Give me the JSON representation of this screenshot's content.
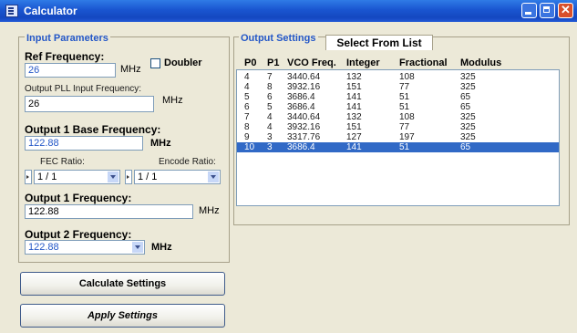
{
  "window": {
    "title": "Calculator"
  },
  "input_params": {
    "section_title": "Input Parameters",
    "ref_freq_label": "Ref Frequency:",
    "ref_freq_value": "26",
    "ref_freq_unit": "MHz",
    "doubler_label": "Doubler",
    "doubler_checked": false,
    "pll_input_label": "Output PLL Input Frequency:",
    "pll_input_value": "26",
    "pll_input_unit": "MHz",
    "out1_base_label": "Output 1 Base Frequency:",
    "out1_base_value": "122.88",
    "out1_base_unit": "MHz",
    "fec_label": "FEC Ratio:",
    "fec_value": "1 / 1",
    "encode_label": "Encode Ratio:",
    "encode_value": "1 / 1",
    "out1_freq_label": "Output 1 Frequency:",
    "out1_freq_value": "122.88",
    "out1_freq_unit": "MHz",
    "out2_freq_label": "Output 2 Frequency:",
    "out2_freq_value": "122.88",
    "out2_freq_unit": "MHz"
  },
  "buttons": {
    "calculate": "Calculate Settings",
    "apply": "Apply Settings"
  },
  "output_settings": {
    "section_title": "Output Settings",
    "tab_label": "Select From List",
    "columns": [
      "P0",
      "P1",
      "VCO Freq.",
      "Integer",
      "Fractional",
      "Modulus"
    ],
    "rows": [
      [
        "4",
        "7",
        "3440.64",
        "132",
        "108",
        "325"
      ],
      [
        "4",
        "8",
        "3932.16",
        "151",
        "77",
        "325"
      ],
      [
        "5",
        "6",
        "3686.4",
        "141",
        "51",
        "65"
      ],
      [
        "6",
        "5",
        "3686.4",
        "141",
        "51",
        "65"
      ],
      [
        "7",
        "4",
        "3440.64",
        "132",
        "108",
        "325"
      ],
      [
        "8",
        "4",
        "3932.16",
        "151",
        "77",
        "325"
      ],
      [
        "9",
        "3",
        "3317.76",
        "127",
        "197",
        "325"
      ],
      [
        "10",
        "3",
        "3686.4",
        "141",
        "51",
        "65"
      ]
    ],
    "selected_row_index": 7
  },
  "colors": {
    "titlebar": "#1A55D0",
    "section_title": "#2457C7",
    "selection": "#3169C6",
    "window_bg": "#ECE9D8"
  },
  "icons": [
    "calculator-app-icon",
    "minimize-icon",
    "maximize-icon",
    "close-icon",
    "dropdown-arrow-icon",
    "spin-arrow-icon"
  ]
}
